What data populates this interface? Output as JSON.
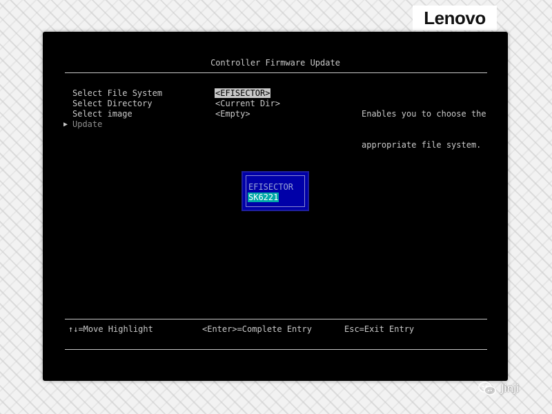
{
  "brand": {
    "logo_text": "Lenovo"
  },
  "screen": {
    "title": "Controller Firmware Update",
    "menu": [
      {
        "label": "Select File System",
        "value": "<EFISECTOR>"
      },
      {
        "label": "Select Directory",
        "value": "<Current Dir>"
      },
      {
        "label": "Select image",
        "value": "<Empty>"
      },
      {
        "label": "Update",
        "pointer": "▶"
      }
    ],
    "help_text": [
      "Enables you to choose the",
      "appropriate file system."
    ],
    "popup": {
      "options": [
        "EFISECTOR",
        "SK6221"
      ],
      "highlighted": "SK6221"
    },
    "footer": {
      "move": "↑↓=Move Highlight",
      "enter": "<Enter>=Complete Entry",
      "esc": "Esc=Exit Entry"
    }
  },
  "watermark": {
    "text": "Jinji",
    "icon": "chat-bubbles-icon"
  },
  "colors": {
    "screen_bg": "#000000",
    "text": "#c9c9c9",
    "popup_bg": "#0000a8",
    "popup_highlight": "#00a8a8",
    "selection": "#c9c9c9"
  }
}
